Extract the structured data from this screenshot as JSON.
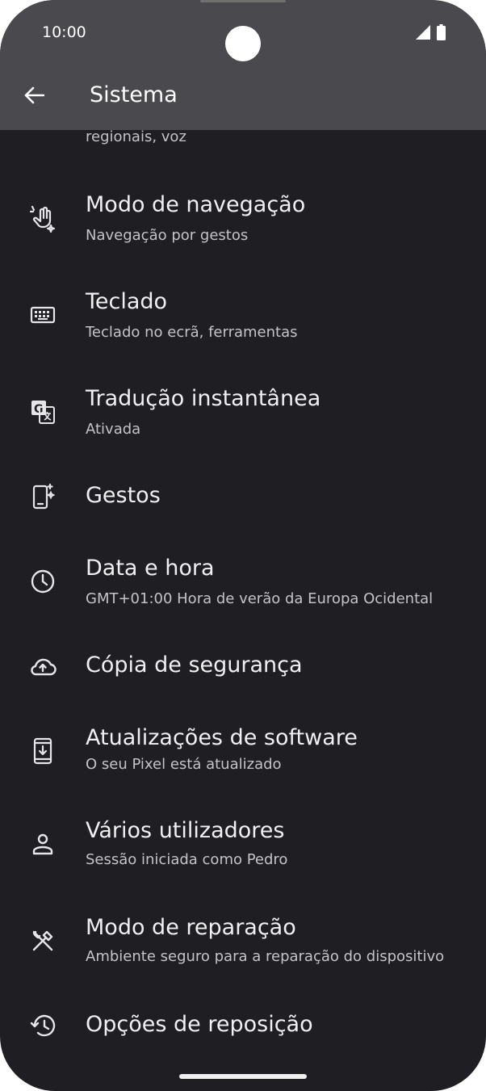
{
  "status_bar": {
    "time": "10:00"
  },
  "header": {
    "title": "Sistema"
  },
  "partial_item": {
    "subtitle": "regionais, voz"
  },
  "items": [
    {
      "label": "Modo de navegação",
      "subtitle": "Navegação por gestos",
      "icon": "gesture-hand-icon"
    },
    {
      "label": "Teclado",
      "subtitle": "Teclado no ecrã, ferramentas",
      "icon": "keyboard-icon"
    },
    {
      "label": "Tradução instantânea",
      "subtitle": "Ativada",
      "icon": "translate-icon"
    },
    {
      "label": "Gestos",
      "subtitle": "",
      "icon": "phone-gesture-icon"
    },
    {
      "label": "Data e hora",
      "subtitle": "GMT+01:00 Hora de verão da Europa Ocidental",
      "icon": "clock-icon"
    },
    {
      "label": "Cópia de segurança",
      "subtitle": "",
      "icon": "cloud-upload-icon"
    },
    {
      "label": "Atualizações de software",
      "subtitle": "O seu Pixel está atualizado",
      "icon": "system-update-icon"
    },
    {
      "label": "Vários utilizadores",
      "subtitle": "Sessão iniciada como Pedro",
      "icon": "person-icon"
    },
    {
      "label": "Modo de reparação",
      "subtitle": "Ambiente seguro para a reparação do dispositivo",
      "icon": "repair-tools-icon"
    },
    {
      "label": "Opções de reposição",
      "subtitle": "",
      "icon": "history-icon"
    }
  ],
  "colors": {
    "background": "#1f1e23",
    "header": "#4a494d",
    "text": "#f0f0f2",
    "subtext": "#c4c4c8"
  }
}
